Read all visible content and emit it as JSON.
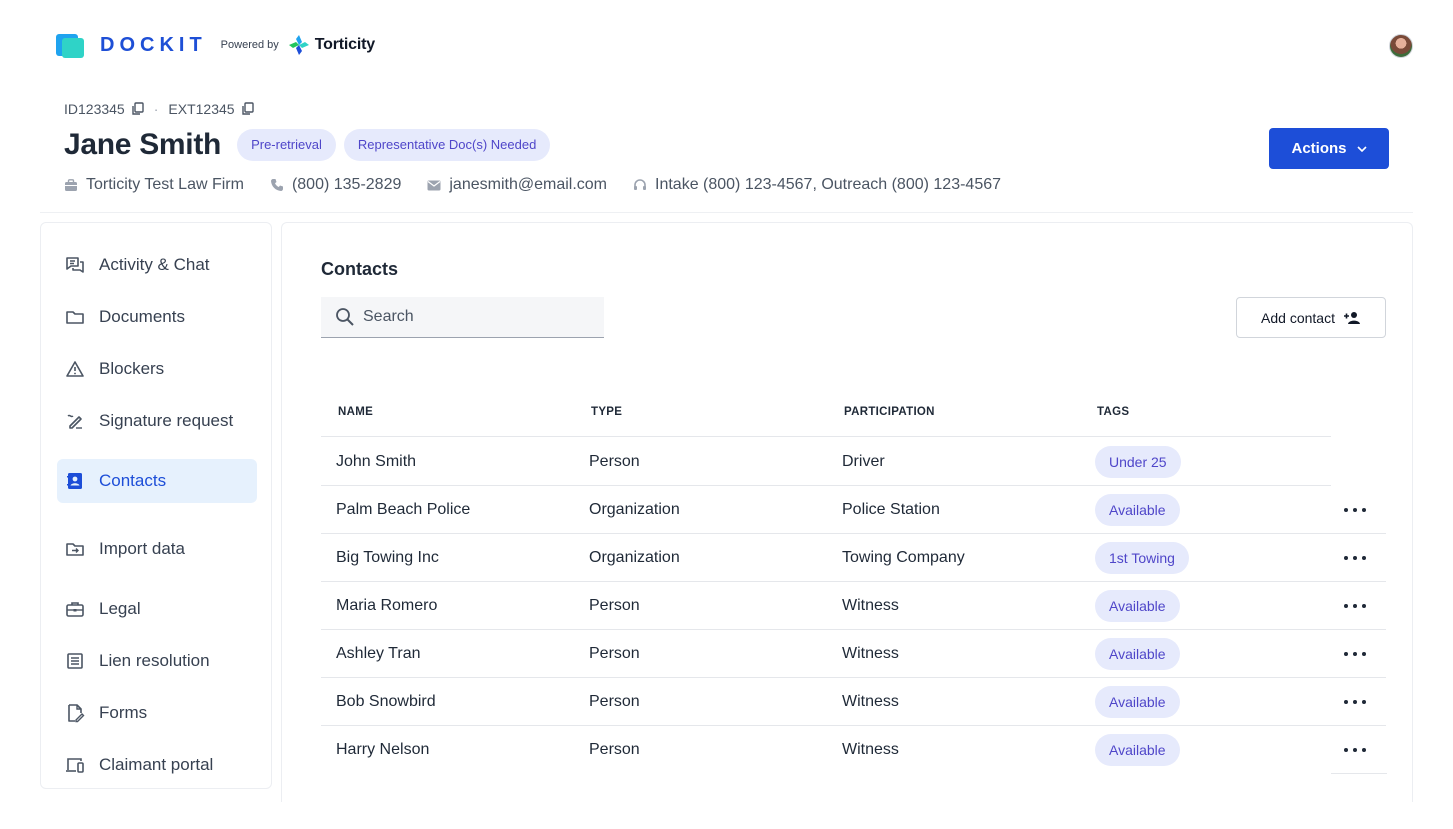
{
  "brand": {
    "name": "DOCKIT",
    "powered_by": "Powered by",
    "partner": "Torticity"
  },
  "header": {
    "id": "ID123345",
    "ext_id": "EXT12345",
    "separator": "·",
    "name": "Jane Smith",
    "chips": [
      "Pre-retrieval",
      "Representative Doc(s) Needed"
    ],
    "firm": "Torticity Test Law Firm",
    "phone": "(800) 135-2829",
    "email": "janesmith@email.com",
    "support": "Intake (800) 123-4567, Outreach (800) 123-4567",
    "actions_label": "Actions"
  },
  "sidebar": {
    "items": [
      {
        "label": "Activity & Chat",
        "icon": "chat-icon"
      },
      {
        "label": "Documents",
        "icon": "folder-icon"
      },
      {
        "label": "Blockers",
        "icon": "warning-icon"
      },
      {
        "label": "Signature request",
        "icon": "signature-icon"
      },
      {
        "label": "Contacts",
        "icon": "contacts-icon",
        "active": true
      },
      {
        "label": "Import data",
        "icon": "import-icon"
      },
      {
        "label": "Legal",
        "icon": "briefcase-icon"
      },
      {
        "label": "Lien resolution",
        "icon": "list-icon"
      },
      {
        "label": "Forms",
        "icon": "form-icon"
      },
      {
        "label": "Claimant portal",
        "icon": "devices-icon"
      }
    ]
  },
  "contacts": {
    "title": "Contacts",
    "search_placeholder": "Search",
    "add_label": "Add contact",
    "columns": [
      "NAME",
      "TYPE",
      "PARTICIPATION",
      "TAGS"
    ],
    "rows": [
      {
        "name": "John Smith",
        "type": "Person",
        "participation": "Driver",
        "tag": "Under 25"
      },
      {
        "name": "Palm Beach Police",
        "type": "Organization",
        "participation": "Police Station",
        "tag": "Available"
      },
      {
        "name": "Big Towing Inc",
        "type": "Organization",
        "participation": "Towing Company",
        "tag": "1st Towing"
      },
      {
        "name": "Maria Romero",
        "type": "Person",
        "participation": "Witness",
        "tag": "Available"
      },
      {
        "name": "Ashley Tran",
        "type": "Person",
        "participation": "Witness",
        "tag": "Available"
      },
      {
        "name": "Bob Snowbird",
        "type": "Person",
        "participation": "Witness",
        "tag": "Available"
      },
      {
        "name": "Harry Nelson",
        "type": "Person",
        "participation": "Witness",
        "tag": "Available"
      }
    ]
  },
  "colors": {
    "accent": "#1d4ed8",
    "chip_bg": "#e6eafc",
    "chip_text": "#4f46c9",
    "active_nav_bg": "#e6f1fd"
  }
}
